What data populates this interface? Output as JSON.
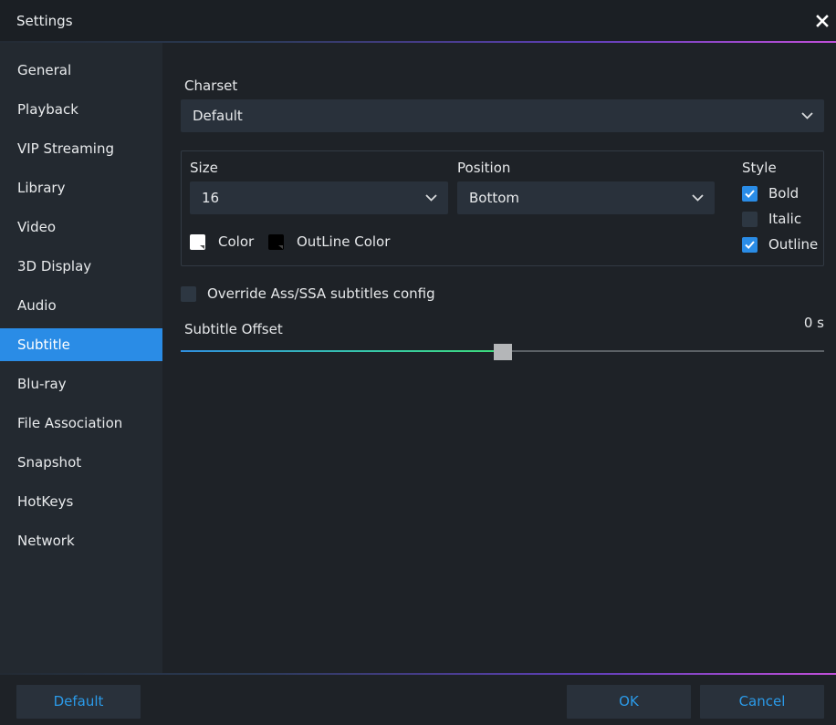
{
  "window": {
    "title": "Settings"
  },
  "sidebar": {
    "items": [
      {
        "label": "General",
        "active": false
      },
      {
        "label": "Playback",
        "active": false
      },
      {
        "label": "VIP Streaming",
        "active": false
      },
      {
        "label": "Library",
        "active": false
      },
      {
        "label": "Video",
        "active": false
      },
      {
        "label": "3D Display",
        "active": false
      },
      {
        "label": "Audio",
        "active": false
      },
      {
        "label": "Subtitle",
        "active": true
      },
      {
        "label": "Blu-ray",
        "active": false
      },
      {
        "label": "File Association",
        "active": false
      },
      {
        "label": "Snapshot",
        "active": false
      },
      {
        "label": "HotKeys",
        "active": false
      },
      {
        "label": "Network",
        "active": false
      }
    ]
  },
  "subtitle": {
    "charset": {
      "label": "Charset",
      "value": "Default"
    },
    "size": {
      "label": "Size",
      "value": "16"
    },
    "position": {
      "label": "Position",
      "value": "Bottom"
    },
    "style": {
      "label": "Style",
      "bold": {
        "label": "Bold",
        "checked": true
      },
      "italic": {
        "label": "Italic",
        "checked": false
      },
      "outline": {
        "label": "Outline",
        "checked": true
      }
    },
    "color": {
      "label": "Color",
      "value": "#ffffff"
    },
    "outline_color": {
      "label": "OutLine Color",
      "value": "#000000"
    },
    "override": {
      "label": "Override Ass/SSA subtitles config",
      "checked": false
    },
    "offset": {
      "label": "Subtitle Offset",
      "display": "0 s",
      "value": 0,
      "fraction": 0.5
    }
  },
  "footer": {
    "default_label": "Default",
    "ok_label": "OK",
    "cancel_label": "Cancel"
  },
  "colors": {
    "accent": "#2a8ce6",
    "button_text": "#2b9ae8",
    "background": "#1e2227",
    "sidebar": "#232930"
  }
}
